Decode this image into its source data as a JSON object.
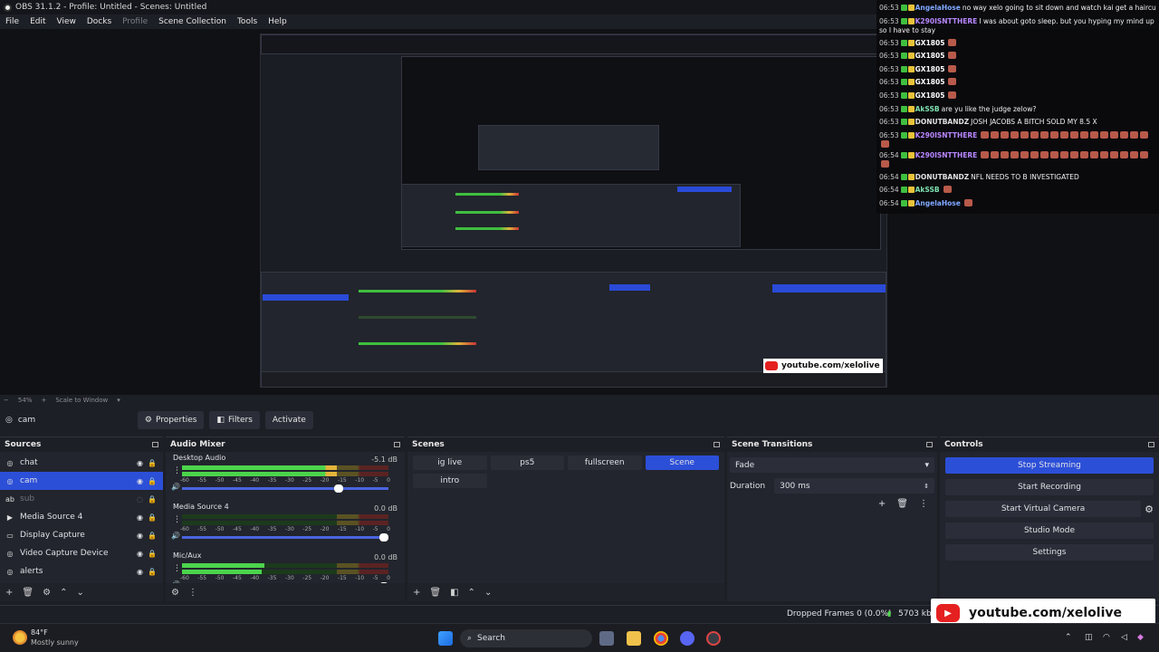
{
  "window": {
    "title": "OBS 31.1.2 - Profile: Untitled - Scenes: Untitled"
  },
  "menu": [
    "File",
    "Edit",
    "View",
    "Docks",
    "Profile",
    "Scene Collection",
    "Tools",
    "Help"
  ],
  "chat": [
    {
      "time": "06:53",
      "user": "AngelaHose",
      "msg": "no way xelo going to sit down and watch kai get a haircut",
      "color": "#7fa8ff"
    },
    {
      "time": "06:53",
      "user": "K290ISNTTHERE",
      "msg": "I was about goto sleep. but you hyping my mind up so I have to stay",
      "color": "#b887ff",
      "wrap": true
    },
    {
      "time": "06:53",
      "user": "GX1805",
      "msg": "",
      "color": "#ffffff",
      "emotes": 1
    },
    {
      "time": "06:53",
      "user": "GX1805",
      "msg": "",
      "color": "#ffffff",
      "emotes": 1
    },
    {
      "time": "06:53",
      "user": "GX1805",
      "msg": "",
      "color": "#ffffff",
      "emotes": 1
    },
    {
      "time": "06:53",
      "user": "GX1805",
      "msg": "",
      "color": "#ffffff",
      "emotes": 1
    },
    {
      "time": "06:53",
      "user": "GX1805",
      "msg": "",
      "color": "#ffffff",
      "emotes": 1
    },
    {
      "time": "06:53",
      "user": "AkSSB",
      "msg": "are yu like the judge zelow?",
      "color": "#7fe0b0"
    },
    {
      "time": "06:53",
      "user": "DONUTBANDZ",
      "msg": "JOSH JACOBS A BITCH SOLD MY 8.5 X",
      "color": "#e0e0e0"
    },
    {
      "time": "06:53",
      "user": "K290ISNTTHERE",
      "msg": "",
      "color": "#b887ff",
      "emotes": 18,
      "wrap": true
    },
    {
      "time": "06:54",
      "user": "K290ISNTTHERE",
      "msg": "",
      "color": "#b887ff",
      "emotes": 18,
      "wrap": true
    },
    {
      "time": "06:54",
      "user": "DONUTBANDZ",
      "msg": "NFL NEEDS TO B INVESTIGATED",
      "color": "#e0e0e0"
    },
    {
      "time": "06:54",
      "user": "AkSSB",
      "msg": "",
      "color": "#7fe0b0",
      "emotes": 1
    },
    {
      "time": "06:54",
      "user": "AngelaHose",
      "msg": "",
      "color": "#7fa8ff",
      "emotes": 1
    }
  ],
  "preview": {
    "overlay_url": "youtube.com/xelolive",
    "zoom": "54%",
    "scale_mode": "Scale to Window"
  },
  "source_toolbar": {
    "current_source": "cam",
    "properties": "Properties",
    "filters": "Filters",
    "activate": "Activate"
  },
  "sources": {
    "title": "Sources",
    "items": [
      {
        "name": "chat",
        "icon": "◎",
        "selected": false,
        "disabled": false
      },
      {
        "name": "cam",
        "icon": "◎",
        "selected": true,
        "disabled": false
      },
      {
        "name": "sub",
        "icon": "ab",
        "selected": false,
        "disabled": true
      },
      {
        "name": "Media Source 4",
        "icon": "▶",
        "selected": false,
        "disabled": false
      },
      {
        "name": "Display Capture",
        "icon": "▭",
        "selected": false,
        "disabled": false
      },
      {
        "name": "Video Capture Device",
        "icon": "◎",
        "selected": false,
        "disabled": false
      },
      {
        "name": "alerts",
        "icon": "◎",
        "selected": false,
        "disabled": false
      }
    ]
  },
  "audio_mixer": {
    "title": "Audio Mixer",
    "scale": [
      "-60",
      "-55",
      "-50",
      "-45",
      "-40",
      "-35",
      "-30",
      "-25",
      "-20",
      "-15",
      "-10",
      "-5",
      "0"
    ],
    "channels": [
      {
        "name": "Desktop Audio",
        "db": "-5.1 dB",
        "level": 0.92,
        "fader": 0.78
      },
      {
        "name": "Media Source 4",
        "db": "0.0 dB",
        "level": 0.0,
        "fader": 1.0
      },
      {
        "name": "Mic/Aux",
        "db": "0.0 dB",
        "level": 0.4,
        "fader": 1.0
      }
    ]
  },
  "scenes": {
    "title": "Scenes",
    "items": [
      {
        "name": "ig live",
        "active": false
      },
      {
        "name": "ps5",
        "active": false
      },
      {
        "name": "fullscreen",
        "active": false
      },
      {
        "name": "Scene",
        "active": true
      },
      {
        "name": "intro",
        "active": false
      }
    ]
  },
  "transitions": {
    "title": "Scene Transitions",
    "type": "Fade",
    "duration_label": "Duration",
    "duration": "300 ms"
  },
  "controls": {
    "title": "Controls",
    "stop_streaming": "Stop Streaming",
    "start_recording": "Start Recording",
    "start_virtual_camera": "Start Virtual Camera",
    "studio_mode": "Studio Mode",
    "settings": "Settings"
  },
  "status": {
    "dropped_frames": "Dropped Frames 0 (0.0%)",
    "bitrate": "5703 kbp"
  },
  "weather": {
    "temp": "84°F",
    "desc": "Mostly sunny"
  },
  "taskbar": {
    "search": "Search"
  },
  "colors": {
    "accent": "#2c4fd8",
    "youtube": "#e52020"
  }
}
